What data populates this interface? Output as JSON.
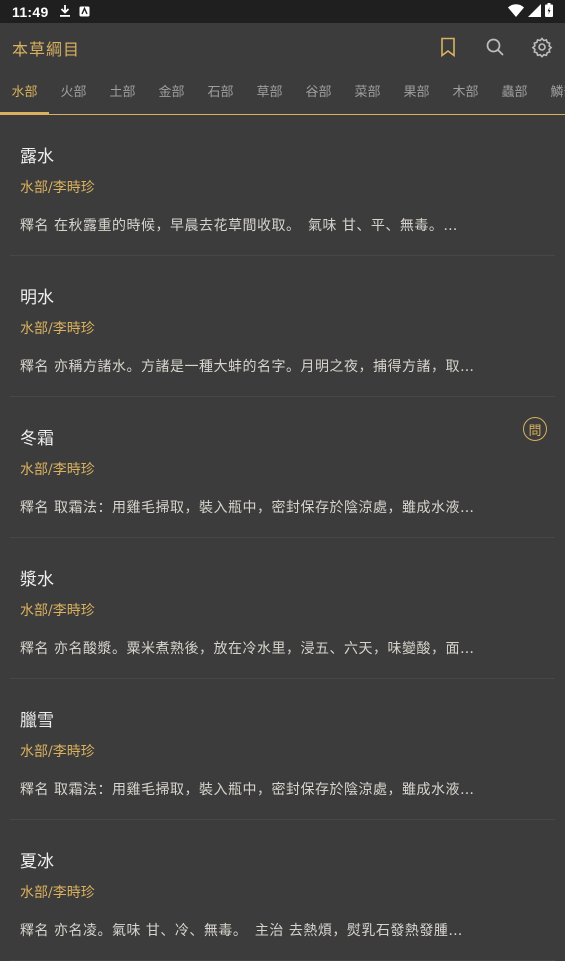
{
  "status": {
    "time": "11:49"
  },
  "app": {
    "title": "本草綱目"
  },
  "tabs": [
    "水部",
    "火部",
    "土部",
    "金部",
    "石部",
    "草部",
    "谷部",
    "菜部",
    "果部",
    "木部",
    "蟲部",
    "鱗部"
  ],
  "active_tab": 0,
  "items": [
    {
      "name": "露水",
      "category": "水部/李時珍",
      "desc": "釋名 在秋露重的時候，早晨去花草間收取。　氣味 甘、平、無毒。…"
    },
    {
      "name": "明水",
      "category": "水部/李時珍",
      "desc": "釋名 亦稱方諸水。方諸是一種大蚌的名字。月明之夜，捕得方諸，取…"
    },
    {
      "name": "冬霜",
      "category": "水部/李時珍",
      "desc": "釋名 取霜法：用雞毛掃取，裝入瓶中，密封保存於陰涼處，雖成水液…",
      "badge": "問"
    },
    {
      "name": "漿水",
      "category": "水部/李時珍",
      "desc": "釋名 亦名酸漿。粟米煮熟後，放在冷水里，浸五、六天，味變酸，面…"
    },
    {
      "name": "臘雪",
      "category": "水部/李時珍",
      "desc": "釋名 取霜法：用雞毛掃取，裝入瓶中，密封保存於陰涼處，雖成水液…"
    },
    {
      "name": "夏冰",
      "category": "水部/李時珍",
      "desc": "釋名 亦名凌。氣味 甘、冷、無毒。　主治 去熱煩，熨乳石發熱發腫…"
    }
  ]
}
